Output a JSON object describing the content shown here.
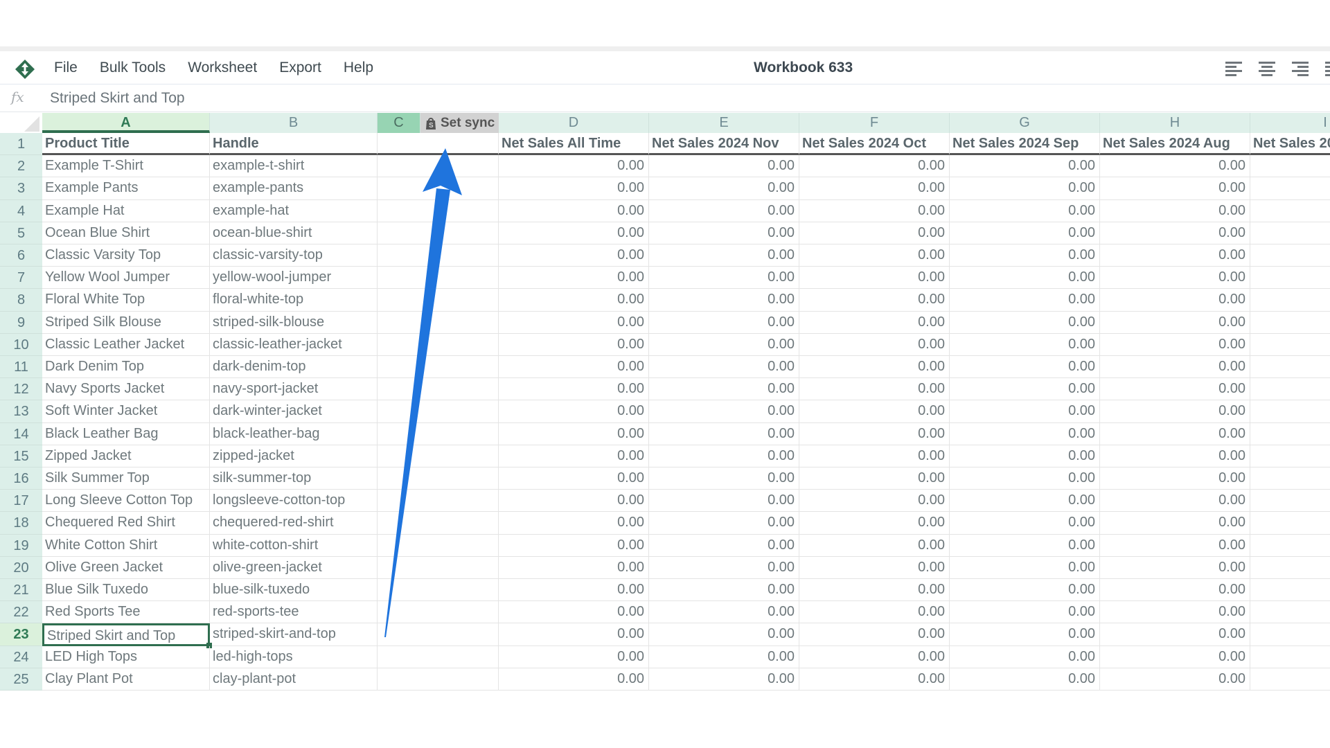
{
  "app": {
    "title": "Workbook 633",
    "menu": [
      "File",
      "Bulk Tools",
      "Worksheet",
      "Export",
      "Help"
    ],
    "align_tools": [
      "align-left",
      "align-center",
      "align-right",
      "align-justify"
    ],
    "accent_color": "#2f6e4f"
  },
  "formula_bar": {
    "fx_label": "fx",
    "value": "Striped Skirt and Top"
  },
  "columns": {
    "letters": [
      "A",
      "B",
      "C",
      "D",
      "E",
      "F",
      "G",
      "H",
      "I"
    ],
    "selected": "A",
    "set_sync_label": "Set sync",
    "set_sync_icon": "shopify-bag-icon"
  },
  "sheet": {
    "headers": [
      "Product Title",
      "Handle",
      "",
      "Net Sales All Time",
      "Net Sales 2024 Nov",
      "Net Sales 2024 Oct",
      "Net Sales 2024 Sep",
      "Net Sales 2024 Aug",
      "Net Sales 20"
    ],
    "rows": [
      {
        "n": "2",
        "title": "Example T-Shirt",
        "handle": "example-t-shirt",
        "values": [
          "0.00",
          "0.00",
          "0.00",
          "0.00",
          "0.00"
        ]
      },
      {
        "n": "3",
        "title": "Example Pants",
        "handle": "example-pants",
        "values": [
          "0.00",
          "0.00",
          "0.00",
          "0.00",
          "0.00"
        ]
      },
      {
        "n": "4",
        "title": "Example Hat",
        "handle": "example-hat",
        "values": [
          "0.00",
          "0.00",
          "0.00",
          "0.00",
          "0.00"
        ]
      },
      {
        "n": "5",
        "title": "Ocean Blue Shirt",
        "handle": "ocean-blue-shirt",
        "values": [
          "0.00",
          "0.00",
          "0.00",
          "0.00",
          "0.00"
        ]
      },
      {
        "n": "6",
        "title": "Classic Varsity Top",
        "handle": "classic-varsity-top",
        "values": [
          "0.00",
          "0.00",
          "0.00",
          "0.00",
          "0.00"
        ]
      },
      {
        "n": "7",
        "title": "Yellow Wool Jumper",
        "handle": "yellow-wool-jumper",
        "values": [
          "0.00",
          "0.00",
          "0.00",
          "0.00",
          "0.00"
        ]
      },
      {
        "n": "8",
        "title": "Floral White Top",
        "handle": "floral-white-top",
        "values": [
          "0.00",
          "0.00",
          "0.00",
          "0.00",
          "0.00"
        ]
      },
      {
        "n": "9",
        "title": "Striped Silk Blouse",
        "handle": "striped-silk-blouse",
        "values": [
          "0.00",
          "0.00",
          "0.00",
          "0.00",
          "0.00"
        ]
      },
      {
        "n": "10",
        "title": "Classic Leather Jacket",
        "handle": "classic-leather-jacket",
        "values": [
          "0.00",
          "0.00",
          "0.00",
          "0.00",
          "0.00"
        ]
      },
      {
        "n": "11",
        "title": "Dark Denim Top",
        "handle": "dark-denim-top",
        "values": [
          "0.00",
          "0.00",
          "0.00",
          "0.00",
          "0.00"
        ]
      },
      {
        "n": "12",
        "title": "Navy Sports Jacket",
        "handle": "navy-sport-jacket",
        "values": [
          "0.00",
          "0.00",
          "0.00",
          "0.00",
          "0.00"
        ]
      },
      {
        "n": "13",
        "title": "Soft Winter Jacket",
        "handle": "dark-winter-jacket",
        "values": [
          "0.00",
          "0.00",
          "0.00",
          "0.00",
          "0.00"
        ]
      },
      {
        "n": "14",
        "title": "Black Leather Bag",
        "handle": "black-leather-bag",
        "values": [
          "0.00",
          "0.00",
          "0.00",
          "0.00",
          "0.00"
        ]
      },
      {
        "n": "15",
        "title": "Zipped Jacket",
        "handle": "zipped-jacket",
        "values": [
          "0.00",
          "0.00",
          "0.00",
          "0.00",
          "0.00"
        ]
      },
      {
        "n": "16",
        "title": "Silk Summer Top",
        "handle": "silk-summer-top",
        "values": [
          "0.00",
          "0.00",
          "0.00",
          "0.00",
          "0.00"
        ]
      },
      {
        "n": "17",
        "title": "Long Sleeve Cotton Top",
        "handle": "longsleeve-cotton-top",
        "values": [
          "0.00",
          "0.00",
          "0.00",
          "0.00",
          "0.00"
        ]
      },
      {
        "n": "18",
        "title": "Chequered Red Shirt",
        "handle": "chequered-red-shirt",
        "values": [
          "0.00",
          "0.00",
          "0.00",
          "0.00",
          "0.00"
        ]
      },
      {
        "n": "19",
        "title": "White Cotton Shirt",
        "handle": "white-cotton-shirt",
        "values": [
          "0.00",
          "0.00",
          "0.00",
          "0.00",
          "0.00"
        ]
      },
      {
        "n": "20",
        "title": "Olive Green Jacket",
        "handle": "olive-green-jacket",
        "values": [
          "0.00",
          "0.00",
          "0.00",
          "0.00",
          "0.00"
        ]
      },
      {
        "n": "21",
        "title": "Blue Silk Tuxedo",
        "handle": "blue-silk-tuxedo",
        "values": [
          "0.00",
          "0.00",
          "0.00",
          "0.00",
          "0.00"
        ]
      },
      {
        "n": "22",
        "title": "Red Sports Tee",
        "handle": "red-sports-tee",
        "values": [
          "0.00",
          "0.00",
          "0.00",
          "0.00",
          "0.00"
        ]
      },
      {
        "n": "23",
        "title": "Striped Skirt and Top",
        "handle": "striped-skirt-and-top",
        "values": [
          "0.00",
          "0.00",
          "0.00",
          "0.00",
          "0.00"
        ]
      },
      {
        "n": "24",
        "title": "LED High Tops",
        "handle": "led-high-tops",
        "values": [
          "0.00",
          "0.00",
          "0.00",
          "0.00",
          "0.00"
        ]
      },
      {
        "n": "25",
        "title": "Clay Plant Pot",
        "handle": "clay-plant-pot",
        "values": [
          "0.00",
          "0.00",
          "0.00",
          "0.00",
          "0.00"
        ]
      }
    ],
    "selected_row": "23",
    "selected_cell": "A23"
  },
  "annotation": {
    "type": "arrow",
    "color": "#1f74dd",
    "points_to": "Set sync"
  }
}
